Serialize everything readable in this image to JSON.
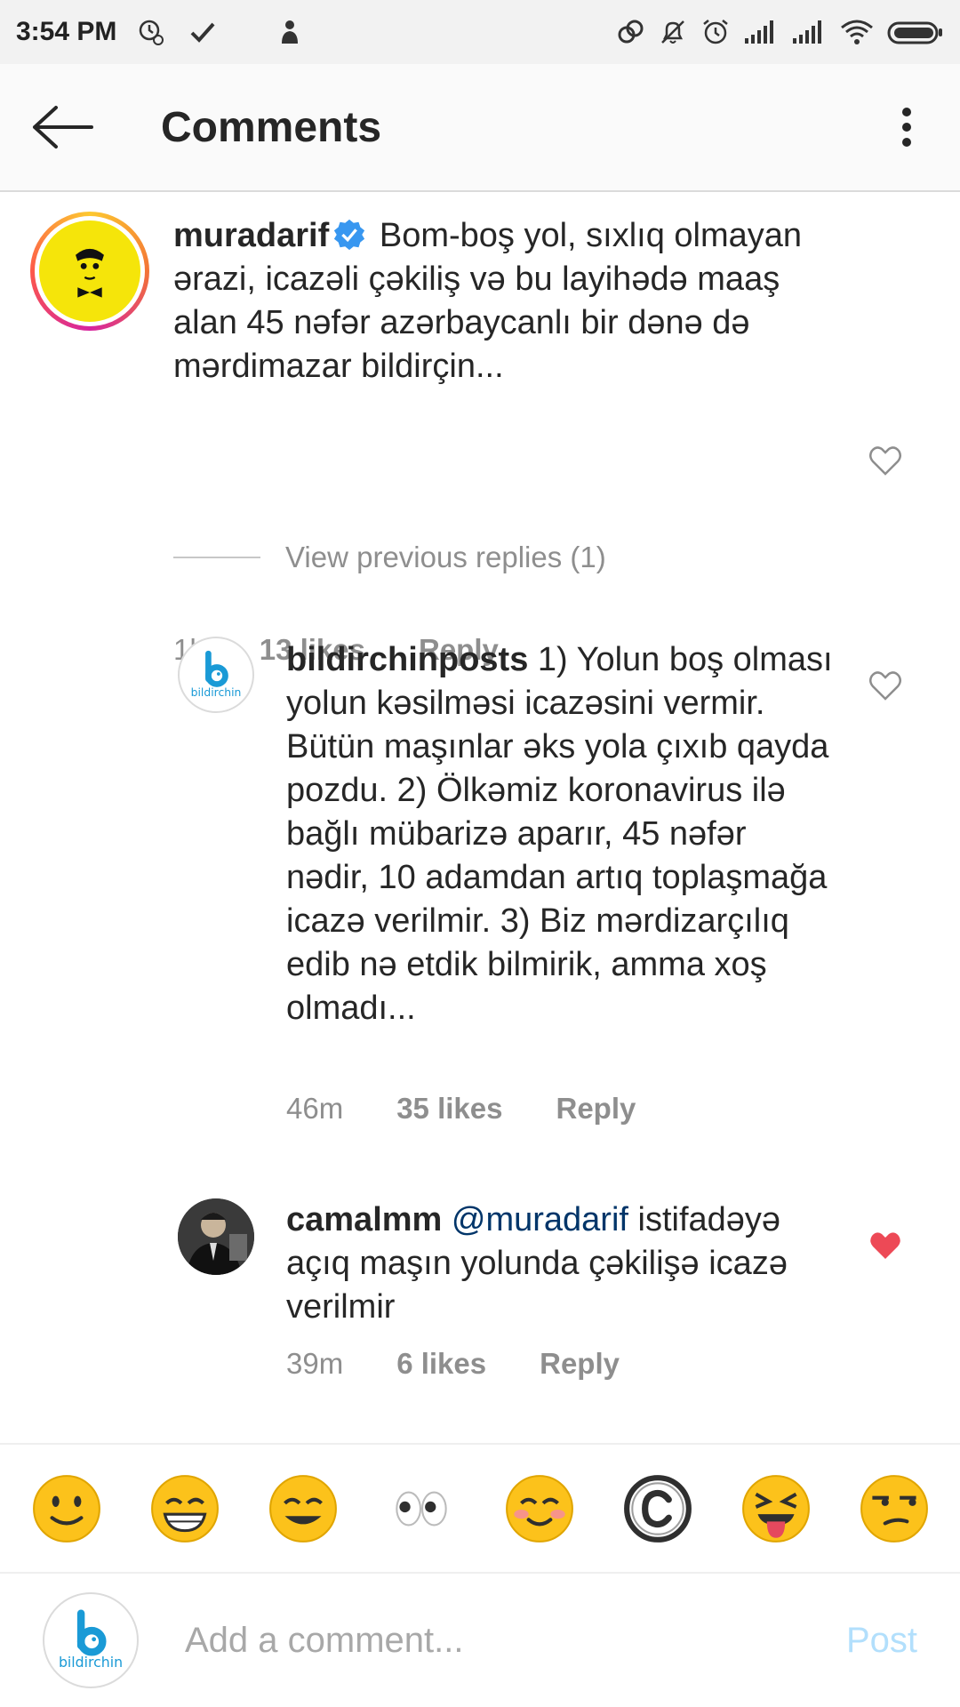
{
  "status_bar": {
    "time": "3:54 PM",
    "left_icons": [
      "sync-icon",
      "check-icon",
      "hand-icon"
    ],
    "right_icons": [
      "link-icon",
      "bell-off-icon",
      "alarm-icon",
      "signal-icon",
      "signal-icon",
      "wifi-icon",
      "battery-icon"
    ]
  },
  "header": {
    "title": "Comments",
    "back_icon": "arrow-left-icon",
    "more_icon": "more-vertical-icon"
  },
  "comments": [
    {
      "username": "muradarif",
      "verified": true,
      "text": "Bom-boş yol, sıxlıq olmayan ərazi, icazəli çəkiliş və bu layihədə maaş alan 45 nəfər azərbaycanlı bir dənə də mərdimazar bildirçin...",
      "time": "1h",
      "likes": "13 likes",
      "reply": "Reply",
      "liked": false
    },
    {
      "username": "bildirchinposts",
      "verified": false,
      "text": "1) Yolun boş olması yolun kəsilməsi icazəsini vermir. Bütün maşınlar əks yola çıxıb qayda pozdu. 2) Ölkəmiz koronavirus ilə bağlı mübarizə aparır, 45 nəfər nədir, 10 adamdan artıq toplaşmağa icazə verilmir. 3) Biz mərdizarçılıq edib nə etdik bilmirik, amma xoş olmadı...",
      "time": "46m",
      "likes": "35 likes",
      "reply": "Reply",
      "liked": false,
      "avatar_label": "bildirchin"
    },
    {
      "username": "camalmm",
      "verified": false,
      "mention": "@muradarif",
      "text": "istifadəyə açıq maşın yolunda çəkilişə icazə verilmir",
      "time": "39m",
      "likes": "6 likes",
      "reply": "Reply",
      "liked": true
    }
  ],
  "view_previous_replies": "View previous replies (1)",
  "emoji_bar": [
    "slightly-smiling-face",
    "grinning-face",
    "smiling-face",
    "eyes",
    "blushing-face",
    "copyright-sign",
    "squinting-tongue-face",
    "unamused-face"
  ],
  "input": {
    "placeholder": "Add a comment...",
    "post_label": "Post",
    "avatar_label": "bildirchin"
  },
  "colors": {
    "text": "#262626",
    "meta": "#8e8e8e",
    "verified": "#3897f0",
    "liked": "#ed4956",
    "post_disabled": "#b2dffc",
    "mention": "#003569"
  }
}
